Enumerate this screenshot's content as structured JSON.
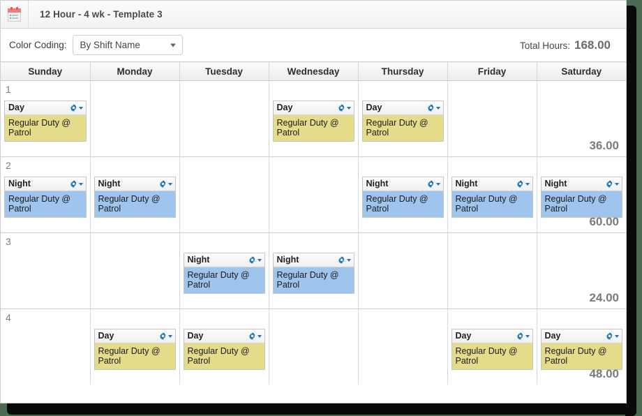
{
  "window": {
    "title": "12 Hour - 4 wk - Template 3",
    "icon": "clipboard-icon"
  },
  "toolbar": {
    "color_coding_label": "Color Coding:",
    "color_coding_value": "By Shift Name",
    "color_coding_options": [
      "By Shift Name"
    ],
    "total_hours_label": "Total Hours:",
    "total_hours_value": "168.00"
  },
  "calendar": {
    "day_headers": [
      "Sunday",
      "Monday",
      "Tuesday",
      "Wednesday",
      "Thursday",
      "Friday",
      "Saturday"
    ],
    "weeks": [
      {
        "number": "1",
        "total": "36.00",
        "days": [
          {
            "shift": {
              "name": "Day",
              "detail": "Regular Duty @ Patrol",
              "type": "day"
            }
          },
          {
            "shift": null
          },
          {
            "shift": null
          },
          {
            "shift": {
              "name": "Day",
              "detail": "Regular Duty @ Patrol",
              "type": "day"
            }
          },
          {
            "shift": {
              "name": "Day",
              "detail": "Regular Duty @ Patrol",
              "type": "day"
            }
          },
          {
            "shift": null
          },
          {
            "shift": null
          }
        ]
      },
      {
        "number": "2",
        "total": "60.00",
        "days": [
          {
            "shift": {
              "name": "Night",
              "detail": "Regular Duty @ Patrol",
              "type": "night"
            }
          },
          {
            "shift": {
              "name": "Night",
              "detail": "Regular Duty @ Patrol",
              "type": "night"
            }
          },
          {
            "shift": null
          },
          {
            "shift": null
          },
          {
            "shift": {
              "name": "Night",
              "detail": "Regular Duty @ Patrol",
              "type": "night"
            }
          },
          {
            "shift": {
              "name": "Night",
              "detail": "Regular Duty @ Patrol",
              "type": "night"
            }
          },
          {
            "shift": {
              "name": "Night",
              "detail": "Regular Duty @ Patrol",
              "type": "night"
            }
          }
        ]
      },
      {
        "number": "3",
        "total": "24.00",
        "days": [
          {
            "shift": null
          },
          {
            "shift": null
          },
          {
            "shift": {
              "name": "Night",
              "detail": "Regular Duty @ Patrol",
              "type": "night"
            }
          },
          {
            "shift": {
              "name": "Night",
              "detail": "Regular Duty @ Patrol",
              "type": "night"
            }
          },
          {
            "shift": null
          },
          {
            "shift": null
          },
          {
            "shift": null
          }
        ]
      },
      {
        "number": "4",
        "total": "48.00",
        "days": [
          {
            "shift": null
          },
          {
            "shift": {
              "name": "Day",
              "detail": "Regular Duty @ Patrol",
              "type": "day"
            }
          },
          {
            "shift": {
              "name": "Day",
              "detail": "Regular Duty @ Patrol",
              "type": "day"
            }
          },
          {
            "shift": null
          },
          {
            "shift": null
          },
          {
            "shift": {
              "name": "Day",
              "detail": "Regular Duty @ Patrol",
              "type": "day"
            }
          },
          {
            "shift": {
              "name": "Day",
              "detail": "Regular Duty @ Patrol",
              "type": "day"
            }
          }
        ]
      }
    ]
  },
  "colors": {
    "day_shift": "#e4dc8b",
    "night_shift": "#9fc5ef",
    "gear_icon": "#1a74bb",
    "total_text": "#6b6b6b"
  }
}
